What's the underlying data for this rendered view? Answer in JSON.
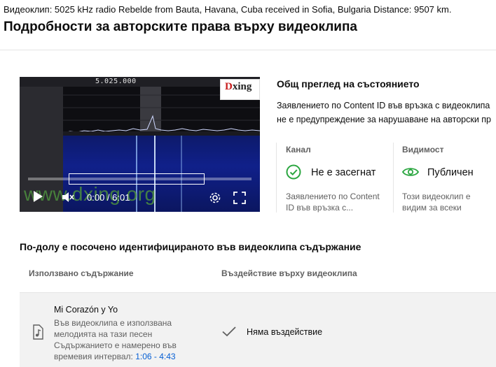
{
  "video": {
    "heading": "Видеоклип: 5025 kHz radio Rebelde from Bauta, Havana, Cuba received in Sofia, Bulgaria Distance: 9507 km.",
    "page_title": "Подробности за авторските права върху видеоклипа"
  },
  "player": {
    "frequency": "5.025.000",
    "logo_text_red": "D",
    "logo_text_dark": "xing",
    "watermark": "www.dxing.org",
    "time": "0:00 / 6:01",
    "state": "paused"
  },
  "overview": {
    "title": "Общ преглед на състоянието",
    "line1": "Заявлението по Content ID във връзка с видеоклипа",
    "line2": "не е предупреждение за нарушаване на авторски пр"
  },
  "channel_card": {
    "label": "Канал",
    "value": "Не е засегнат",
    "desc_line1": "Заявлението по Content",
    "desc_line2": "ID във връзка с..."
  },
  "visibility_card": {
    "label": "Видимост",
    "value": "Публичен",
    "desc_line1": "Този видеоклип е",
    "desc_line2": "видим за всеки"
  },
  "content_section": {
    "title": "По-долу е посочено идентифицираното във видеоклипа съдържание",
    "col_used": "Използвано съдържание",
    "col_impact": "Въздействие върху видеоклипа",
    "rows": [
      {
        "song": "Mi Corazón y Yo",
        "desc_line1": "Във видеоклипа е използвана",
        "desc_line2": "мелодията на тази песен",
        "desc_line3": "Съдържанието е намерено във",
        "desc_line4_prefix": "времевия интервал: ",
        "interval": "1:06 - 4:43",
        "impact": "Няма въздействие"
      }
    ]
  },
  "colors": {
    "success_green": "#2ba640",
    "link_blue": "#065fd4",
    "muted_text": "#606060"
  }
}
